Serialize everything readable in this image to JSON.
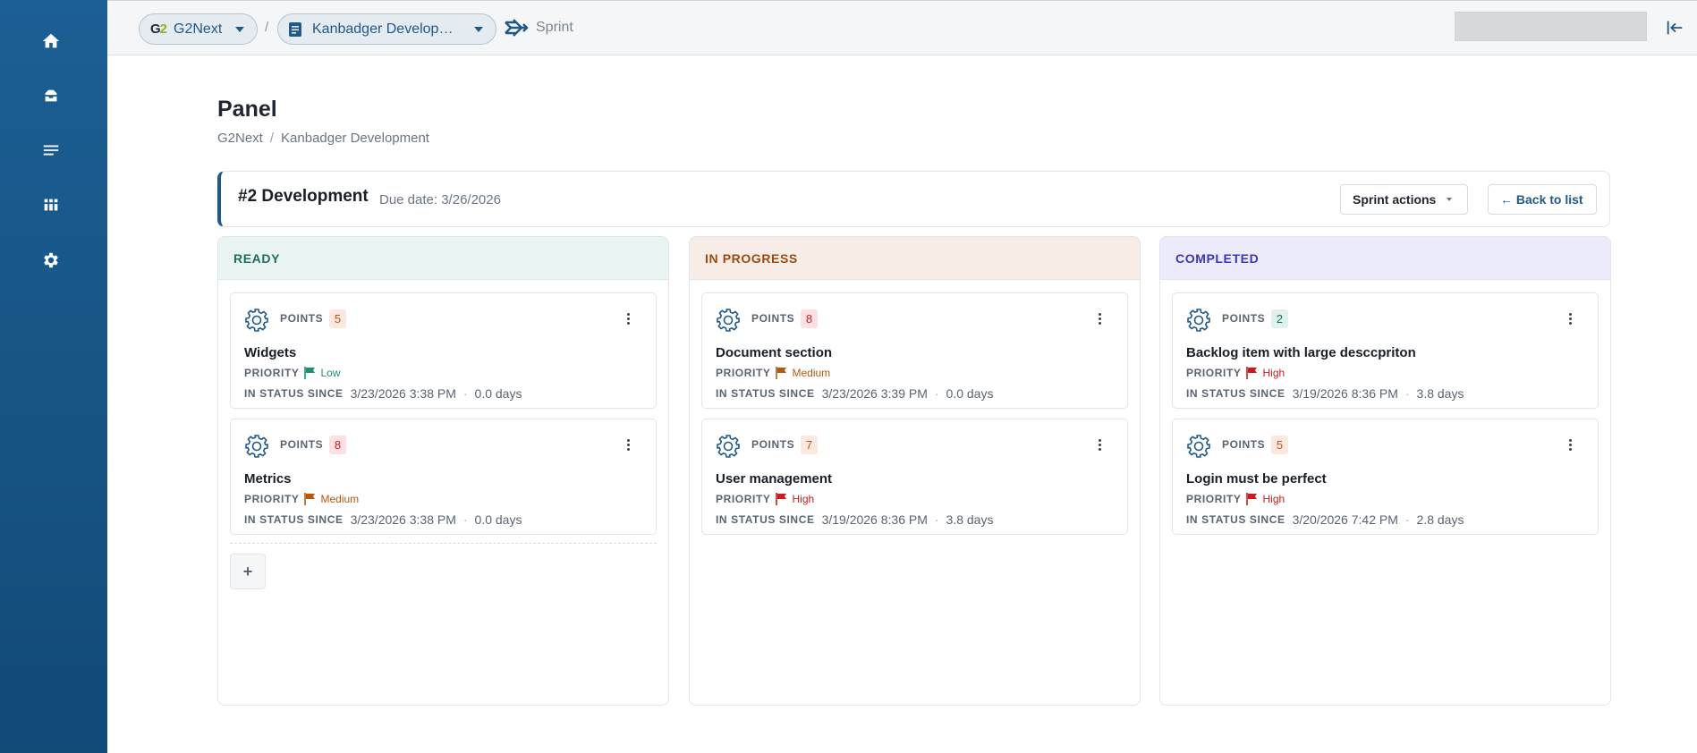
{
  "sidebar": {
    "items": [
      {
        "icon": "home-icon"
      },
      {
        "icon": "inbox-icon"
      },
      {
        "icon": "list-icon"
      },
      {
        "icon": "board-icon"
      },
      {
        "icon": "gear-icon"
      }
    ]
  },
  "topbar": {
    "org_logo": "G2",
    "org_label": "G2Next",
    "separator": "/",
    "project_label": "Kanbadger Develop…",
    "sprint_label": "Sprint"
  },
  "page": {
    "title": "Panel",
    "breadcrumb": [
      "G2Next",
      "Kanbadger Development"
    ]
  },
  "sprint": {
    "name": "#2 Development",
    "due": "Due date: 3/26/2026",
    "actions_label": "Sprint actions",
    "back_label": "← Back to list"
  },
  "labels": {
    "points": "POINTS",
    "priority": "PRIORITY",
    "in_status_since": "IN STATUS SINCE",
    "add": "+"
  },
  "columns": [
    {
      "title": "READY",
      "cards": [
        {
          "points": "5",
          "title": "Widgets",
          "priority": "Low",
          "since": "3/23/2026 3:38 PM",
          "days": "0.0 days"
        },
        {
          "points": "8",
          "title": "Metrics",
          "priority": "Medium",
          "since": "3/23/2026 3:38 PM",
          "days": "0.0 days"
        }
      ]
    },
    {
      "title": "IN PROGRESS",
      "cards": [
        {
          "points": "8",
          "title": "Document section",
          "priority": "Medium",
          "since": "3/23/2026 3:39 PM",
          "days": "0.0 days"
        },
        {
          "points": "7",
          "title": "User management",
          "priority": "High",
          "since": "3/19/2026 8:36 PM",
          "days": "3.8 days"
        }
      ]
    },
    {
      "title": "COMPLETED",
      "cards": [
        {
          "points": "2",
          "title": "Backlog item with large desccpriton",
          "priority": "High",
          "since": "3/19/2026 8:36 PM",
          "days": "3.8 days"
        },
        {
          "points": "5",
          "title": "Login must be perfect",
          "priority": "High",
          "since": "3/20/2026 7:42 PM",
          "days": "2.8 days"
        }
      ]
    }
  ],
  "colors": {
    "sidebar": "#1c5f94",
    "accent": "#1f5a8a",
    "priority_low": "#1a8f78",
    "priority_medium": "#b35a0e",
    "priority_high": "#c91d1d"
  }
}
